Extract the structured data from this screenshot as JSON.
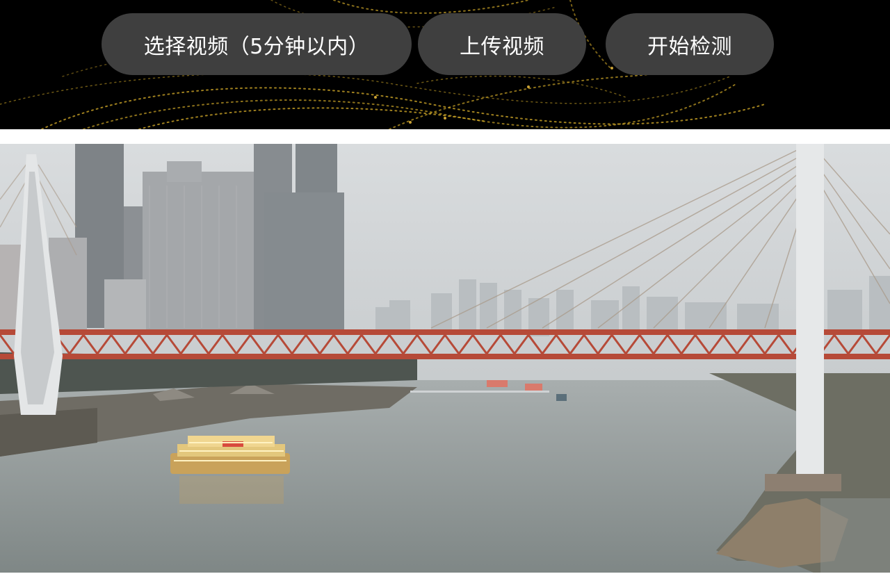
{
  "toolbar": {
    "select_label": "选择视频（5分钟以内）",
    "upload_label": "上传视频",
    "detect_label": "开始检测"
  },
  "colors": {
    "header_bg": "#000000",
    "button_bg": "#3f3f3f",
    "button_text": "#ffffff",
    "swirl_accent": "#c9a227"
  },
  "icons": {
    "header_decoration": "golden-swirl-pattern"
  },
  "video": {
    "scene": "river-bridge-city-frame"
  }
}
